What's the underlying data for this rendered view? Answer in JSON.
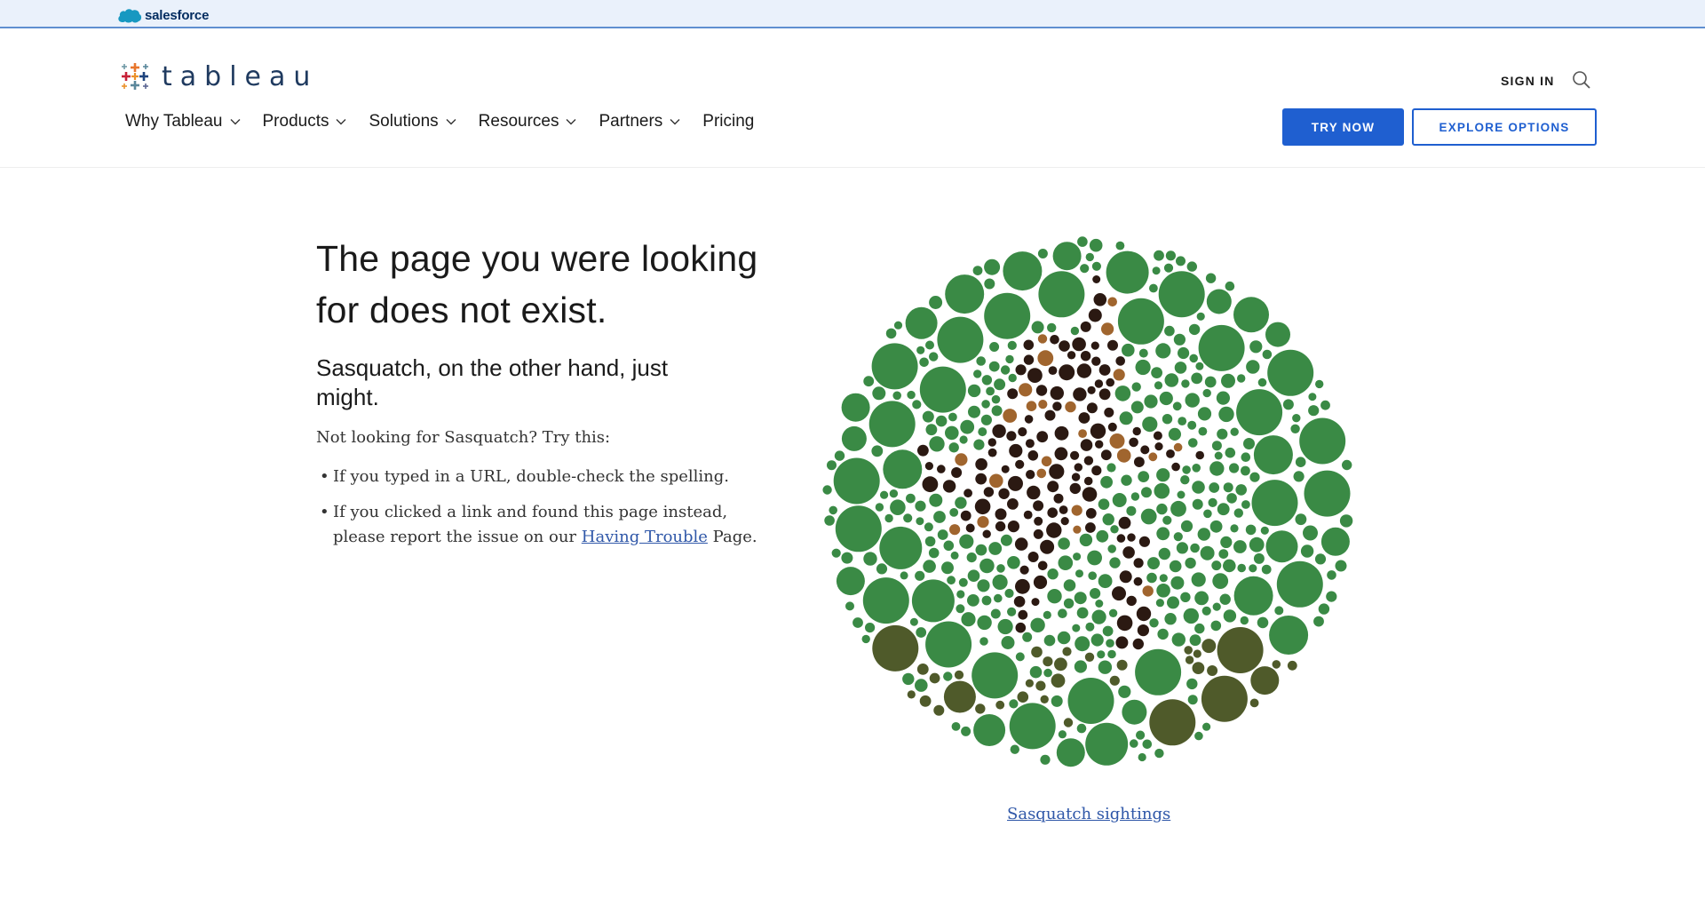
{
  "brand": {
    "parent": "salesforce",
    "name": "tableau"
  },
  "header": {
    "nav": [
      {
        "label": "Why Tableau",
        "has_menu": true
      },
      {
        "label": "Products",
        "has_menu": true
      },
      {
        "label": "Solutions",
        "has_menu": true
      },
      {
        "label": "Resources",
        "has_menu": true
      },
      {
        "label": "Partners",
        "has_menu": true
      },
      {
        "label": "Pricing",
        "has_menu": false
      }
    ],
    "sign_in": "SIGN IN",
    "try_now": "TRY NOW",
    "explore": "EXPLORE OPTIONS"
  },
  "main": {
    "title": "The page you were looking for does not exist.",
    "subtitle": "Sasquatch, on the other hand, just might.",
    "lead": "Not looking for Sasquatch? Try this:",
    "tip1": "If you typed in a URL, double-check the spelling.",
    "tip2_before": "If you clicked a link and found this page instead, please report the issue on our ",
    "tip2_link": "Having Trouble",
    "tip2_after": " Page.",
    "sightings_link": "Sasquatch sightings"
  },
  "colors": {
    "accent": "#1f5fd0",
    "link": "#2f57a8",
    "green": "#3a8a45",
    "dark_brown": "#2b1912",
    "olive": "#4f5a2a",
    "tan": "#a0652e"
  },
  "icons": {
    "search": "search-icon",
    "chevron": "chevron-down-icon"
  }
}
